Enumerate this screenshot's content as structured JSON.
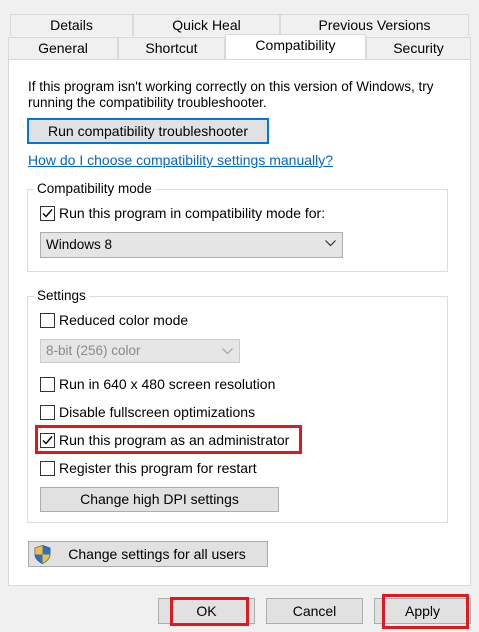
{
  "tabs": {
    "row1": [
      "Details",
      "Quick Heal",
      "Previous Versions"
    ],
    "row2": [
      "General",
      "Shortcut",
      "Compatibility",
      "Security"
    ],
    "active": "Compatibility"
  },
  "intro": {
    "line1": "If this program isn't working correctly on this version of Windows, try",
    "line2": "running the compatibility troubleshooter."
  },
  "troubleshooter_button": "Run compatibility troubleshooter",
  "manual_link": "How do I choose compatibility settings manually?",
  "compat_mode": {
    "legend": "Compatibility mode",
    "checkbox_label": "Run this program in compatibility mode for:",
    "checked": true,
    "selected_os": "Windows 8"
  },
  "settings": {
    "legend": "Settings",
    "reduced_color": {
      "label": "Reduced color mode",
      "checked": false
    },
    "color_select": "8-bit (256) color",
    "resolution": {
      "label": "Run in 640 x 480 screen resolution",
      "checked": false
    },
    "fullscreen": {
      "label": "Disable fullscreen optimizations",
      "checked": false
    },
    "admin": {
      "label": "Run this program as an administrator",
      "checked": true
    },
    "restart": {
      "label": "Register this program for restart",
      "checked": false
    },
    "dpi_button": "Change high DPI settings"
  },
  "all_users_button": "Change settings for all users",
  "footer": {
    "ok": "OK",
    "cancel": "Cancel",
    "apply": "Apply"
  },
  "colors": {
    "highlight": "#e0191f",
    "link": "#0066cc",
    "focus": "#0078d7"
  }
}
